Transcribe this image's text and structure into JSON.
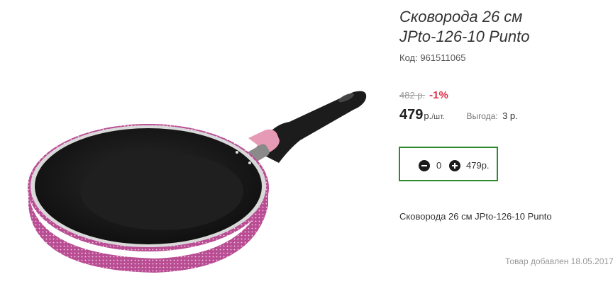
{
  "product": {
    "title_line1": "Сковорода 26 см",
    "title_line2": "JPto-126-10 Punto",
    "code_label": "Код:",
    "code_value": "961511065",
    "image_icon": "frying-pan-image"
  },
  "pricing": {
    "old_price": "482 р.",
    "discount": "-1%",
    "price": "479",
    "currency": "р.",
    "per_unit": "/шт.",
    "benefit_label": "Выгода:",
    "benefit_value": "3 р."
  },
  "cart": {
    "minus_icon": "minus-circle-icon",
    "plus_icon": "plus-circle-icon",
    "quantity": "0",
    "total": "479р.",
    "border_color": "#2d8a2d"
  },
  "description": "Сковорода 26 см JPto-126-10 Punto",
  "footer": {
    "added_text": "Товар добавлен 18.05.2017"
  },
  "colors": {
    "discount": "#e0304a",
    "pan_body": "#b94d93",
    "handle_accent": "#e79ab6"
  }
}
